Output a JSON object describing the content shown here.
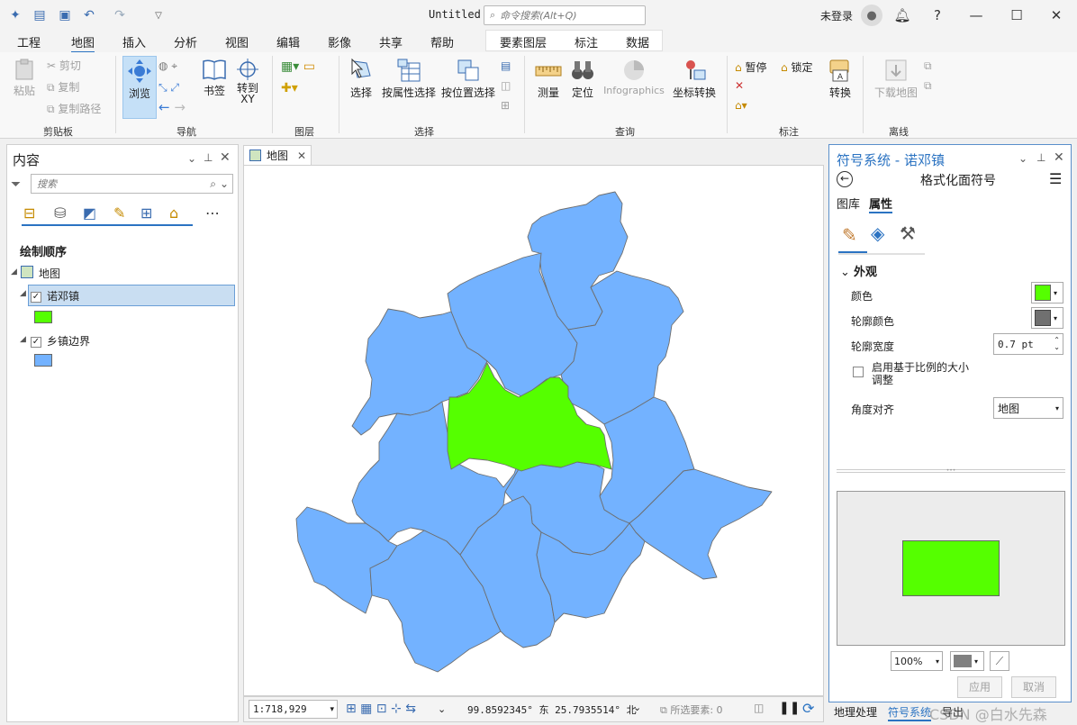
{
  "titlebar": {
    "doc_title": "Untitled",
    "search_placeholder": "命令搜索(Alt+Q)",
    "login": "未登录"
  },
  "tabs": [
    "工程",
    "地图",
    "插入",
    "分析",
    "视图",
    "编辑",
    "影像",
    "共享",
    "帮助"
  ],
  "context_tabs": [
    "要素图层",
    "标注",
    "数据"
  ],
  "ribbon": {
    "paste": "粘贴",
    "cut": "剪切",
    "copy": "复制",
    "copy_path": "复制路径",
    "browse": "浏览",
    "bookmark": "书签",
    "goto_xy": "转到 XY",
    "select": "选择",
    "select_by_attr": "按属性选择",
    "select_by_loc": "按位置选择",
    "measure": "测量",
    "locate": "定位",
    "infographics": "Infographics",
    "coord_convert": "坐标转换",
    "pause": "暂停",
    "lock": "锁定",
    "convert": "转换",
    "download_map": "下载地图",
    "groups": {
      "clipboard": "剪贴板",
      "navigate": "导航",
      "layer": "图层",
      "selection": "选择",
      "inquiry": "查询",
      "labeling": "标注",
      "offline": "离线"
    }
  },
  "contents": {
    "title": "内容",
    "search_placeholder": "搜索",
    "draw_order": "绘制顺序",
    "map": "地图",
    "layers": [
      {
        "name": "诺邓镇",
        "color": "#55ff00",
        "checked": true,
        "selected": true
      },
      {
        "name": "乡镇边界",
        "color": "#73b2ff",
        "checked": true,
        "selected": false
      }
    ]
  },
  "map_view": {
    "tab": "地图",
    "scale": "1:718,929",
    "coords": "99.8592345° 东  25.7935514° 北",
    "selected_features": "所选要素: 0",
    "region_fill": "#73b2ff",
    "highlight_fill": "#55ff00"
  },
  "symbology": {
    "title": "符号系统 - 诺邓镇",
    "subtitle": "格式化面符号",
    "tab_gallery": "图库",
    "tab_properties": "属性",
    "section": "外观",
    "color_label": "颜色",
    "color_value": "#55ff00",
    "outline_color_label": "轮廓颜色",
    "outline_color_value": "#707070",
    "outline_width_label": "轮廓宽度",
    "outline_width_value": "0.7 pt",
    "scale_checkbox": "启用基于比例的大小调整",
    "angle_label": "角度对齐",
    "angle_value": "地图",
    "zoom": "100%",
    "apply": "应用",
    "cancel": "取消"
  },
  "bottom_tabs": [
    "地理处理",
    "符号系统",
    "导出"
  ],
  "watermark": "CSDN @白水先森"
}
